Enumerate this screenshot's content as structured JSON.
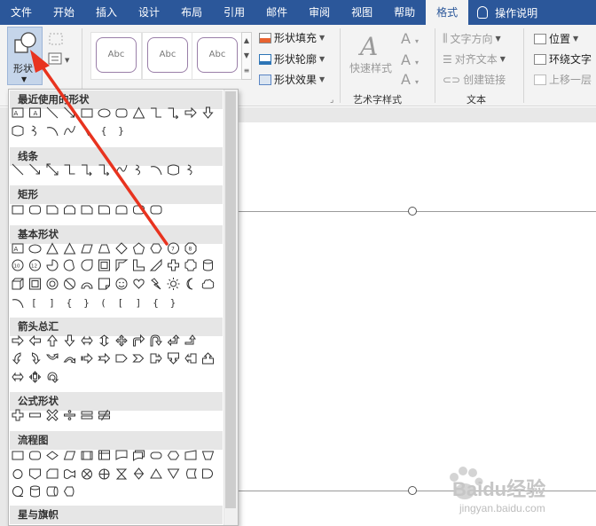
{
  "tabs": [
    "文件",
    "开始",
    "插入",
    "设计",
    "布局",
    "引用",
    "邮件",
    "审阅",
    "视图",
    "帮助",
    "格式"
  ],
  "help_search": "操作说明",
  "ribbon": {
    "shape_button": "形状",
    "style_sample": "Abc",
    "shape_fill": "形状填充",
    "shape_outline": "形状轮廓",
    "shape_effects": "形状效果",
    "quick_styles": "快速样式",
    "wordart_group": "艺术字样式",
    "text_direction": "文字方向",
    "align_text": "对齐文本",
    "create_link": "创建链接",
    "text_group": "文本",
    "position": "位置",
    "wrap_text": "环绕文字",
    "bring_forward": "上移一层"
  },
  "dropdown": {
    "sections": [
      "最近使用的形状",
      "线条",
      "矩形",
      "基本形状",
      "箭头总汇",
      "公式形状",
      "流程图",
      "星与旗帜"
    ]
  },
  "watermark": {
    "brand": "Baidu经验",
    "url": "jingyan.baidu.com"
  },
  "colors": {
    "tabbar": "#2b579a",
    "annotation_arrow": "#e8331f",
    "ribbon_bg": "#f3f3f3"
  }
}
